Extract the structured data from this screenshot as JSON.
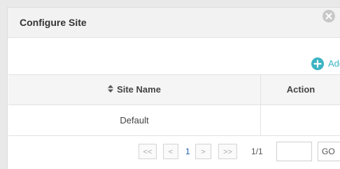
{
  "dialog": {
    "title": "Configure Site"
  },
  "toolbar": {
    "add_label": "Add"
  },
  "table": {
    "columns": {
      "site_name": "Site Name",
      "action": "Action"
    },
    "rows": [
      {
        "site_name": "Default",
        "action": ""
      }
    ]
  },
  "pagination": {
    "first": "<<",
    "prev": "<",
    "current_page": "1",
    "next": ">",
    "last": ">>",
    "page_count": "1/1",
    "goto_value": "",
    "go_label": "GO"
  },
  "colors": {
    "accent": "#3bb3c3",
    "header_bg": "#f2f2f2",
    "page_link": "#1b5fa8"
  },
  "icons": {
    "close": "close-circle-icon",
    "add": "plus-circle-icon",
    "sort": "sort-icon"
  }
}
